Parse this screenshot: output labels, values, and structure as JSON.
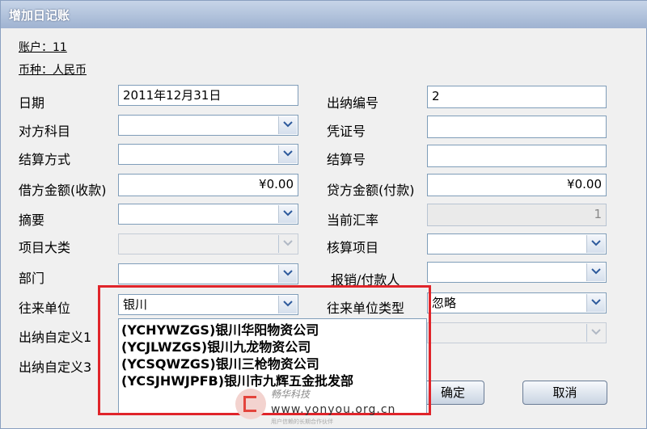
{
  "window": {
    "title": "增加日记账"
  },
  "info": {
    "account": "账户：11",
    "currency": "币种：人民币"
  },
  "fields": {
    "date": {
      "label": "日期",
      "value": "2011年12月31日"
    },
    "cashier_no": {
      "label": "出纳编号",
      "value": "2"
    },
    "counter_account": {
      "label": "对方科目",
      "value": ""
    },
    "voucher_no": {
      "label": "凭证号",
      "value": ""
    },
    "settlement_method": {
      "label": "结算方式",
      "value": ""
    },
    "settlement_no": {
      "label": "结算号",
      "value": ""
    },
    "debit_amount": {
      "label": "借方金额(收款)",
      "value": "¥0.00"
    },
    "credit_amount": {
      "label": "贷方金额(付款)",
      "value": "¥0.00"
    },
    "summary": {
      "label": "摘要",
      "value": ""
    },
    "exchange_rate": {
      "label": "当前汇率",
      "value": "1"
    },
    "project_category": {
      "label": "项目大类",
      "value": ""
    },
    "accounting_item": {
      "label": "核算项目",
      "value": ""
    },
    "department": {
      "label": "部门",
      "value": ""
    },
    "reimburser": {
      "label": "报销/付款人",
      "value": ""
    },
    "counterparty": {
      "label": "往来单位",
      "value": "银川"
    },
    "counterparty_type": {
      "label": "往来单位类型",
      "value": "忽略"
    },
    "custom1": {
      "label": "出纳自定义1",
      "value": ""
    },
    "custom3": {
      "label": "出纳自定义3",
      "value": ""
    }
  },
  "dropdown": {
    "items": [
      "(YCHYWZGS)银川华阳物资公司",
      "(YCJLWZGS)银川九龙物资公司",
      "(YCSQWZGS)银川三枪物资公司",
      "(YCSJHWJPFB)银川市九辉五金批发部"
    ]
  },
  "buttons": {
    "ok": "确定",
    "cancel": "取消"
  },
  "watermark": {
    "cn": "畅华科技",
    "url": "www.yonyou.org.cn",
    "sub": "用户信赖的长期合作伙伴"
  },
  "colors": {
    "highlight": "#e0242a",
    "title_bar": "#9fb3d1"
  }
}
